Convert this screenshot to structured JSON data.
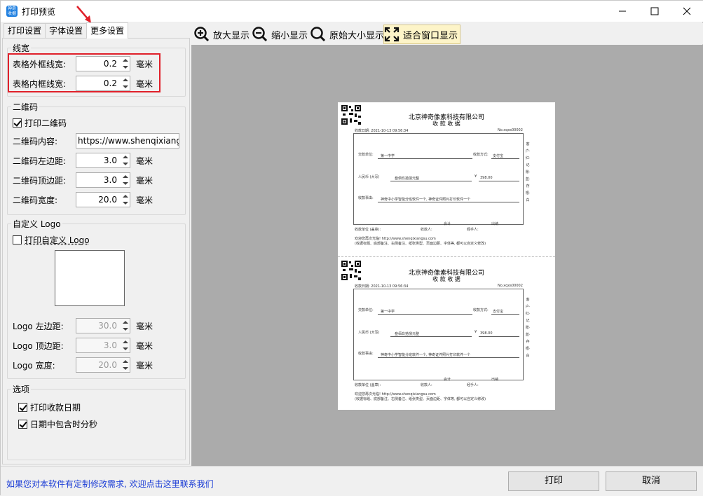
{
  "window": {
    "title": "打印预览",
    "icon_text": "神奇 收据",
    "controls": [
      "minimize-icon",
      "maximize-icon",
      "close-icon"
    ]
  },
  "tabs": [
    {
      "label": "打印设置",
      "active": false
    },
    {
      "label": "字体设置",
      "active": false
    },
    {
      "label": "更多设置",
      "active": true
    }
  ],
  "line_width": {
    "title": "线宽",
    "outer_label": "表格外框线宽:",
    "outer_value": "0.2",
    "inner_label": "表格内框线宽:",
    "inner_value": "0.2",
    "unit": "毫米"
  },
  "qrcode": {
    "title": "二维码",
    "print_label": "打印二维码",
    "print_checked": true,
    "content_label": "二维码内容:",
    "content_value": "https://www.shenqixiangs",
    "left_label": "二维码左边距:",
    "left_value": "3.0",
    "top_label": "二维码顶边距:",
    "top_value": "3.0",
    "width_label": "二维码宽度:",
    "width_value": "20.0",
    "unit": "毫米"
  },
  "logo": {
    "title": "自定义 Logo",
    "print_label": "打印自定义 Logo",
    "print_checked": false,
    "left_label": "Logo 左边距:",
    "left_value": "30.0",
    "top_label": "Logo 顶边距:",
    "top_value": "3.0",
    "width_label": "Logo 宽度:",
    "width_value": "20.0",
    "unit": "毫米"
  },
  "options": {
    "title": "选项",
    "print_date_label": "打印收款日期",
    "print_date_checked": true,
    "include_time_label": "日期中包含时分秒",
    "include_time_checked": true
  },
  "toolbar": {
    "zoom_in": "放大显示",
    "zoom_out": "缩小显示",
    "original": "原始大小显示",
    "fit": "适合窗口显示",
    "active": "fit"
  },
  "receipt": {
    "company": "北京神奇像素科技有限公司",
    "subtitle": "收 款 收 据",
    "date": "收款日期: 2021-10-13 09:56:34",
    "number": "No.xqxs00002",
    "payer_label": "交款单位:",
    "payer": "第一中学",
    "method_label": "收款方式:",
    "method": "支付宝",
    "amount_cn_label": "人民币 (大写)",
    "amount_cn": "叁佰玖拾捌元整",
    "amount_symbol": "¥",
    "amount": "398.00",
    "reason_label": "收款事由:",
    "reason": "神奇中小学智能分班软件一个, 神奇证件照片打印软件一个",
    "accountant": "会计",
    "cashier_sign": "出纳",
    "unit_seal": "收款单位 (盖章):",
    "receiver": "收款人:",
    "handler": "经手人:",
    "side_text": "客户·红·记账·蓝·存根·白",
    "footer1": "欢迎您再次光临! http://www.shenqixiangsu.com",
    "footer2": "(收据标题、底部备注、右侧备注、纸张类型、页面边距、字体等, 都可以自定义修改)"
  },
  "bottom": {
    "link": "如果您对本软件有定制修改需求, 欢迎点击这里联系我们",
    "print_button": "打印",
    "cancel_button": "取消"
  }
}
